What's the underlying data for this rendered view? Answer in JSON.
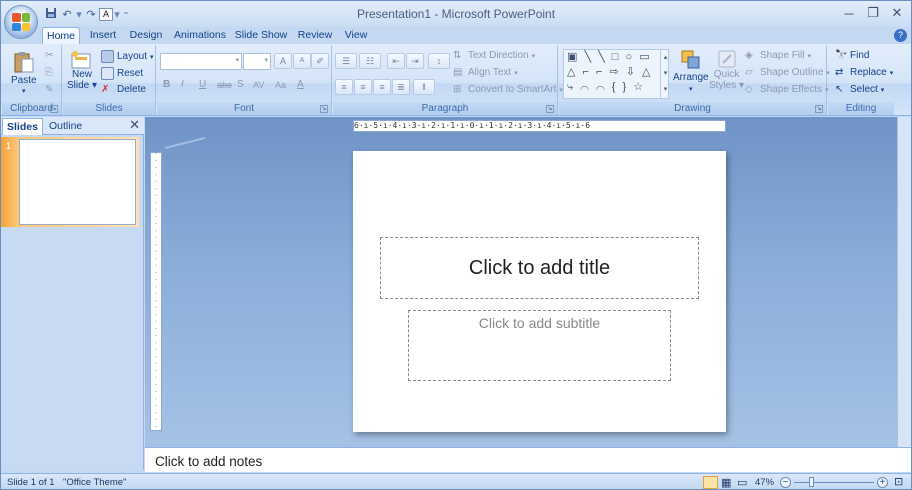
{
  "window": {
    "title": "Presentation1 - Microsoft PowerPoint"
  },
  "qat": {
    "save_icon": "save-icon",
    "undo": "↶",
    "redo": "↷",
    "font_a": "A"
  },
  "tabs": [
    {
      "label": "Home",
      "active": true
    },
    {
      "label": "Insert"
    },
    {
      "label": "Design"
    },
    {
      "label": "Animations"
    },
    {
      "label": "Slide Show"
    },
    {
      "label": "Review"
    },
    {
      "label": "View"
    }
  ],
  "ribbon": {
    "clipboard": {
      "label": "Clipboard",
      "paste": "Paste"
    },
    "slides": {
      "label": "Slides",
      "new_slide_1": "New",
      "new_slide_2": "Slide",
      "layout": "Layout",
      "reset": "Reset",
      "delete": "Delete"
    },
    "font": {
      "label": "Font",
      "bold": "B",
      "italic": "I",
      "underline": "U",
      "strike": "abe",
      "shadow": "S",
      "spacing": "AV",
      "case": "Aa",
      "color": "A",
      "grow": "A",
      "shrink": "A"
    },
    "paragraph": {
      "label": "Paragraph",
      "text_direction": "Text Direction",
      "align_text": "Align Text",
      "convert_smartart": "Convert to SmartArt"
    },
    "drawing": {
      "label": "Drawing",
      "arrange": "Arrange",
      "quick_styles_1": "Quick",
      "quick_styles_2": "Styles",
      "shape_fill": "Shape Fill",
      "shape_outline": "Shape Outline",
      "shape_effects": "Shape Effects"
    },
    "editing": {
      "label": "Editing",
      "find": "Find",
      "replace": "Replace",
      "select": "Select"
    }
  },
  "left_panel": {
    "tab_slides": "Slides",
    "tab_outline": "Outline",
    "close": "✕",
    "slide_number": "1"
  },
  "ruler": {
    "h": "6·ı·5·ı·4·ı·3·ı·2·ı·1·ı·0·ı·1·ı·2·ı·3·ı·4·ı·5·ı·6"
  },
  "slide": {
    "title_placeholder": "Click to add title",
    "subtitle_placeholder": "Click to add subtitle"
  },
  "notes": {
    "placeholder": "Click to add notes"
  },
  "status": {
    "slide_of": "Slide 1 of 1",
    "theme": "\"Office Theme\"",
    "zoom": "47%",
    "zoom_level": 0.47
  },
  "colors": {
    "accent": "#15428b",
    "selected_thumb": "#f6a33a"
  }
}
